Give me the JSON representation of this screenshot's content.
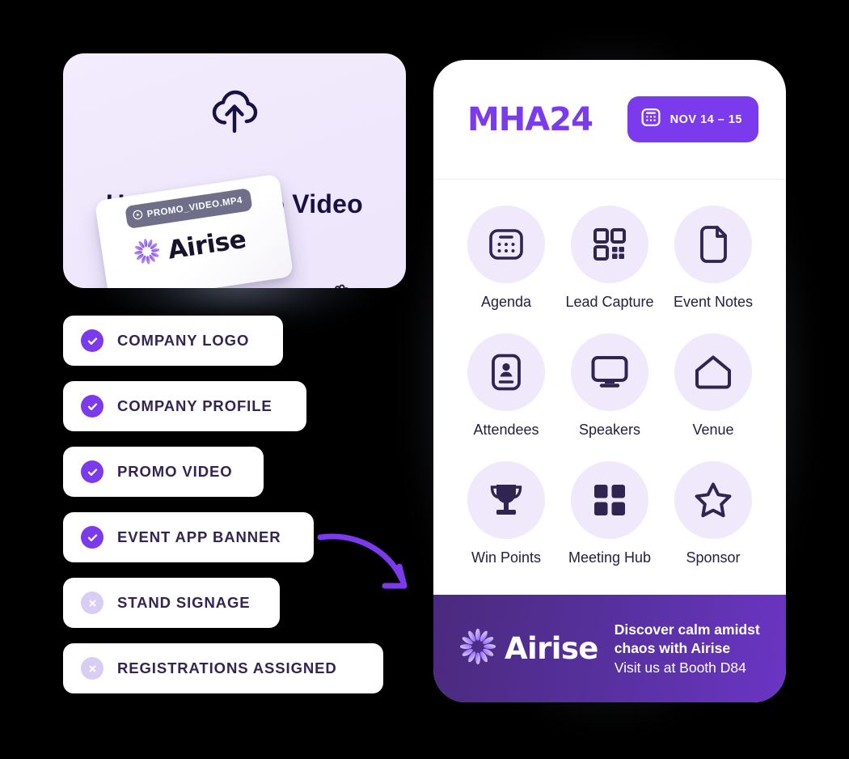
{
  "upload_card": {
    "icon": "cloud-upload-icon",
    "title": "Upload Promo Video",
    "file_badge": {
      "icon": "play-circle-icon",
      "filename": "PROMO_VIDEO.MP4"
    },
    "file_brand": {
      "logo": "airise-flower-logo",
      "name": "Airise"
    },
    "cursor": "grab-hand-cursor"
  },
  "checklist": {
    "items": [
      {
        "label": "COMPANY LOGO",
        "state": "done",
        "icon": "check-circle-icon"
      },
      {
        "label": "COMPANY PROFILE",
        "state": "done",
        "icon": "check-circle-icon"
      },
      {
        "label": "PROMO VIDEO",
        "state": "done",
        "icon": "check-circle-icon"
      },
      {
        "label": "EVENT APP BANNER",
        "state": "done",
        "icon": "check-circle-icon"
      },
      {
        "label": "STAND SIGNAGE",
        "state": "todo",
        "icon": "x-circle-icon"
      },
      {
        "label": "REGISTRATIONS ASSIGNED",
        "state": "todo",
        "icon": "x-circle-icon"
      }
    ]
  },
  "arrow": {
    "icon": "curved-arrow-icon"
  },
  "phone": {
    "header": {
      "event_logo": "MHA24",
      "date_badge": {
        "icon": "calendar-icon",
        "text": "NOV 14 – 15"
      }
    },
    "app_grid": [
      {
        "label": "Agenda",
        "icon": "calendar-agenda-icon"
      },
      {
        "label": "Lead Capture",
        "icon": "qr-code-icon"
      },
      {
        "label": "Event Notes",
        "icon": "document-icon"
      },
      {
        "label": "Attendees",
        "icon": "id-badge-person-icon"
      },
      {
        "label": "Speakers",
        "icon": "monitor-screen-icon"
      },
      {
        "label": "Venue",
        "icon": "home-icon"
      },
      {
        "label": "Win Points",
        "icon": "trophy-icon"
      },
      {
        "label": "Meeting Hub",
        "icon": "grid-squares-icon"
      },
      {
        "label": "Sponsor",
        "icon": "star-icon"
      }
    ],
    "promo_banner": {
      "logo": "airise-flower-logo",
      "brand": "Airise",
      "line1": "Discover calm amidst",
      "line2": "chaos with Airise",
      "line3": "Visit us at Booth D84"
    }
  },
  "colors": {
    "background": "#000000",
    "accent_purple": "#7C3AED",
    "card_lavender": "#EFE9FB",
    "upload_card_bg": "#F2ECFD",
    "dark_navy_text": "#181244",
    "checklist_text": "#342450",
    "todo_badge": "#D9CDF3",
    "banner_purple_dark": "#4A2A7D",
    "banner_purple_light": "#6B35C4"
  }
}
